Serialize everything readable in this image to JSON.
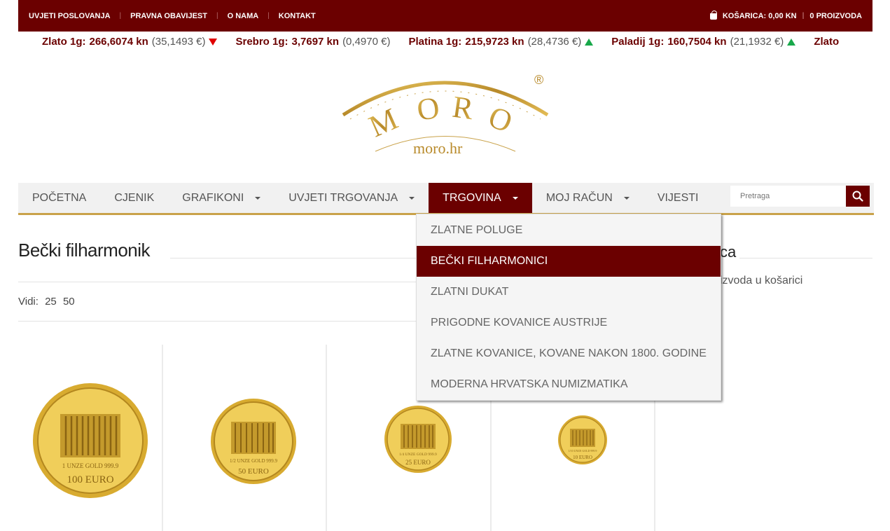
{
  "topbar": {
    "links": [
      "UVJETI POSLOVANJA",
      "PRAVNA OBAVIJEST",
      "O NAMA",
      "KONTAKT"
    ],
    "cart_label": "KOŠARICA: 0,00 KN",
    "cart_count": "0 PROIZVODA"
  },
  "ticker": [
    {
      "name": "Zlato 1g:",
      "price": "266,6074 kn",
      "eur": "(35,1493 €)",
      "trend": "down"
    },
    {
      "name": "Srebro 1g:",
      "price": "3,7697 kn",
      "eur": "(0,4970 €)",
      "trend": "none"
    },
    {
      "name": "Platina 1g:",
      "price": "215,9723 kn",
      "eur": "(28,4736 €)",
      "trend": "up"
    },
    {
      "name": "Paladij 1g:",
      "price": "160,7504 kn",
      "eur": "(21,1932 €)",
      "trend": "up"
    },
    {
      "name": "Zlato",
      "price": "",
      "eur": "",
      "trend": "none"
    }
  ],
  "logo": {
    "word": "M O R O",
    "domain": "moro.hr",
    "reg": "®"
  },
  "nav": {
    "items": [
      {
        "label": "POČETNA",
        "dropdown": false,
        "active": false
      },
      {
        "label": "CJENIK",
        "dropdown": false,
        "active": false
      },
      {
        "label": "GRAFIKONI",
        "dropdown": true,
        "active": false
      },
      {
        "label": "UVJETI TRGOVANJA",
        "dropdown": true,
        "active": false
      },
      {
        "label": "TRGOVINA",
        "dropdown": true,
        "active": true
      },
      {
        "label": "MOJ RAČUN",
        "dropdown": true,
        "active": false
      },
      {
        "label": "VIJESTI",
        "dropdown": false,
        "active": false
      }
    ],
    "search_placeholder": "Pretraga"
  },
  "dropdown": {
    "items": [
      {
        "label": "ZLATNE POLUGE",
        "active": false
      },
      {
        "label": "BEČKI FILHARMONICI",
        "active": true
      },
      {
        "label": "ZLATNI DUKAT",
        "active": false
      },
      {
        "label": "PRIGODNE KOVANICE AUSTRIJE",
        "active": false
      },
      {
        "label": "ZLATNE KOVANICE, KOVANE NAKON 1800. GODINE",
        "active": false
      },
      {
        "label": "MODERNA HRVATSKA NUMIZMATIKA",
        "active": false
      }
    ]
  },
  "main": {
    "title": "Bečki filharmonik",
    "vidi_label": "Vidi:",
    "vidi_options": [
      "25",
      "50"
    ]
  },
  "sidebar": {
    "title_fragment": "ca",
    "text_fragment": "izvoda u košarici"
  },
  "products": [
    {
      "coin": "1 UNZE GOLD 999.9",
      "value": "100 EURO"
    },
    {
      "coin": "1/2 UNZE GOLD 999.9",
      "value": "50 EURO"
    },
    {
      "coin": "1/4 UNZE GOLD 999.9",
      "value": "25 EURO"
    },
    {
      "coin": "1/10 UNZE GOLD 999.9",
      "value": "10 EURO"
    }
  ],
  "colors": {
    "brand": "#6b0000",
    "accent": "#c9a24a",
    "up": "#18a84a",
    "down": "#e00000"
  }
}
